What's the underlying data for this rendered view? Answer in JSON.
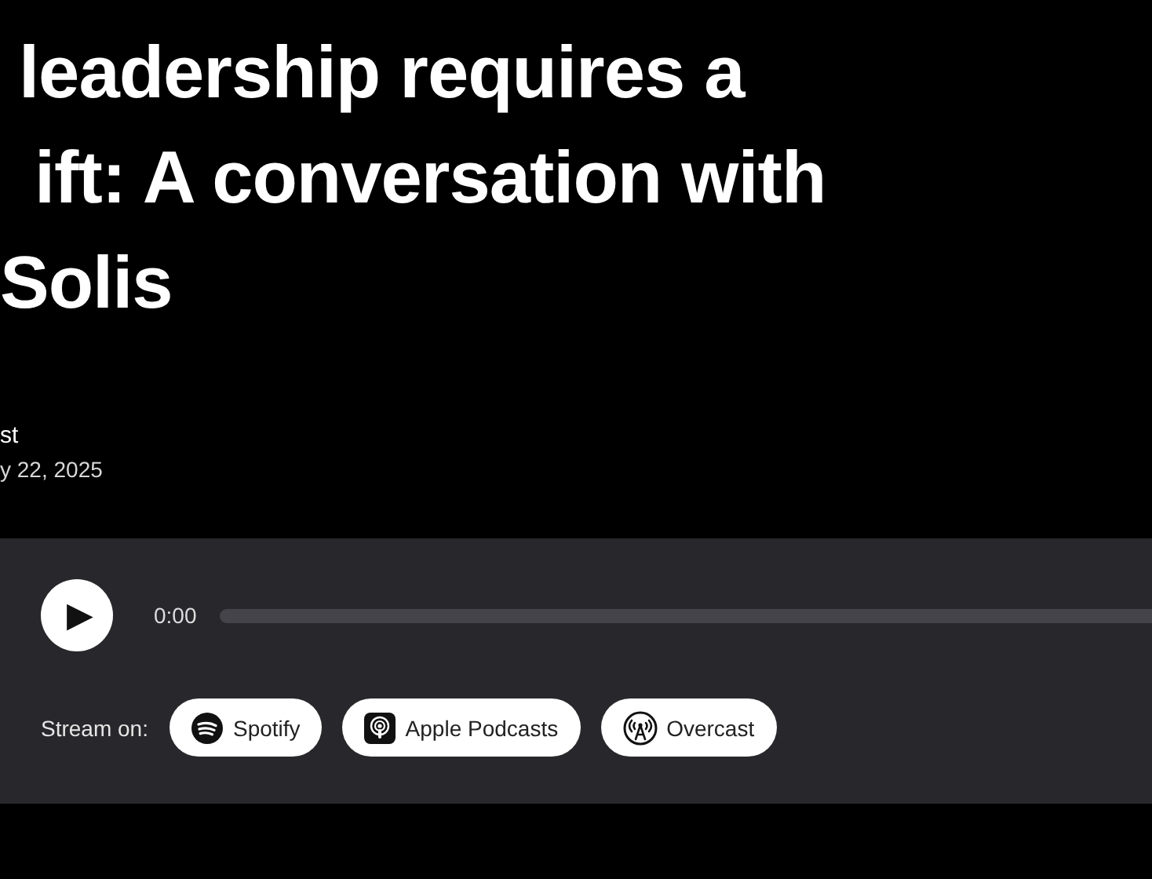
{
  "title_lines": [
    "leadership requires a",
    "ift: A conversation with",
    "Solis"
  ],
  "meta": {
    "author": "st",
    "date": "y 22, 2025"
  },
  "player": {
    "play_button": "▶",
    "time": "0:00",
    "progress": {
      "level": 0
    }
  },
  "stream": {
    "label": "Stream on:",
    "services": [
      {
        "kind": "spotify",
        "label": "Spotify"
      },
      {
        "kind": "apple",
        "label": "Apple Podcasts"
      },
      {
        "kind": "overcast",
        "label": "Overcast"
      }
    ]
  }
}
